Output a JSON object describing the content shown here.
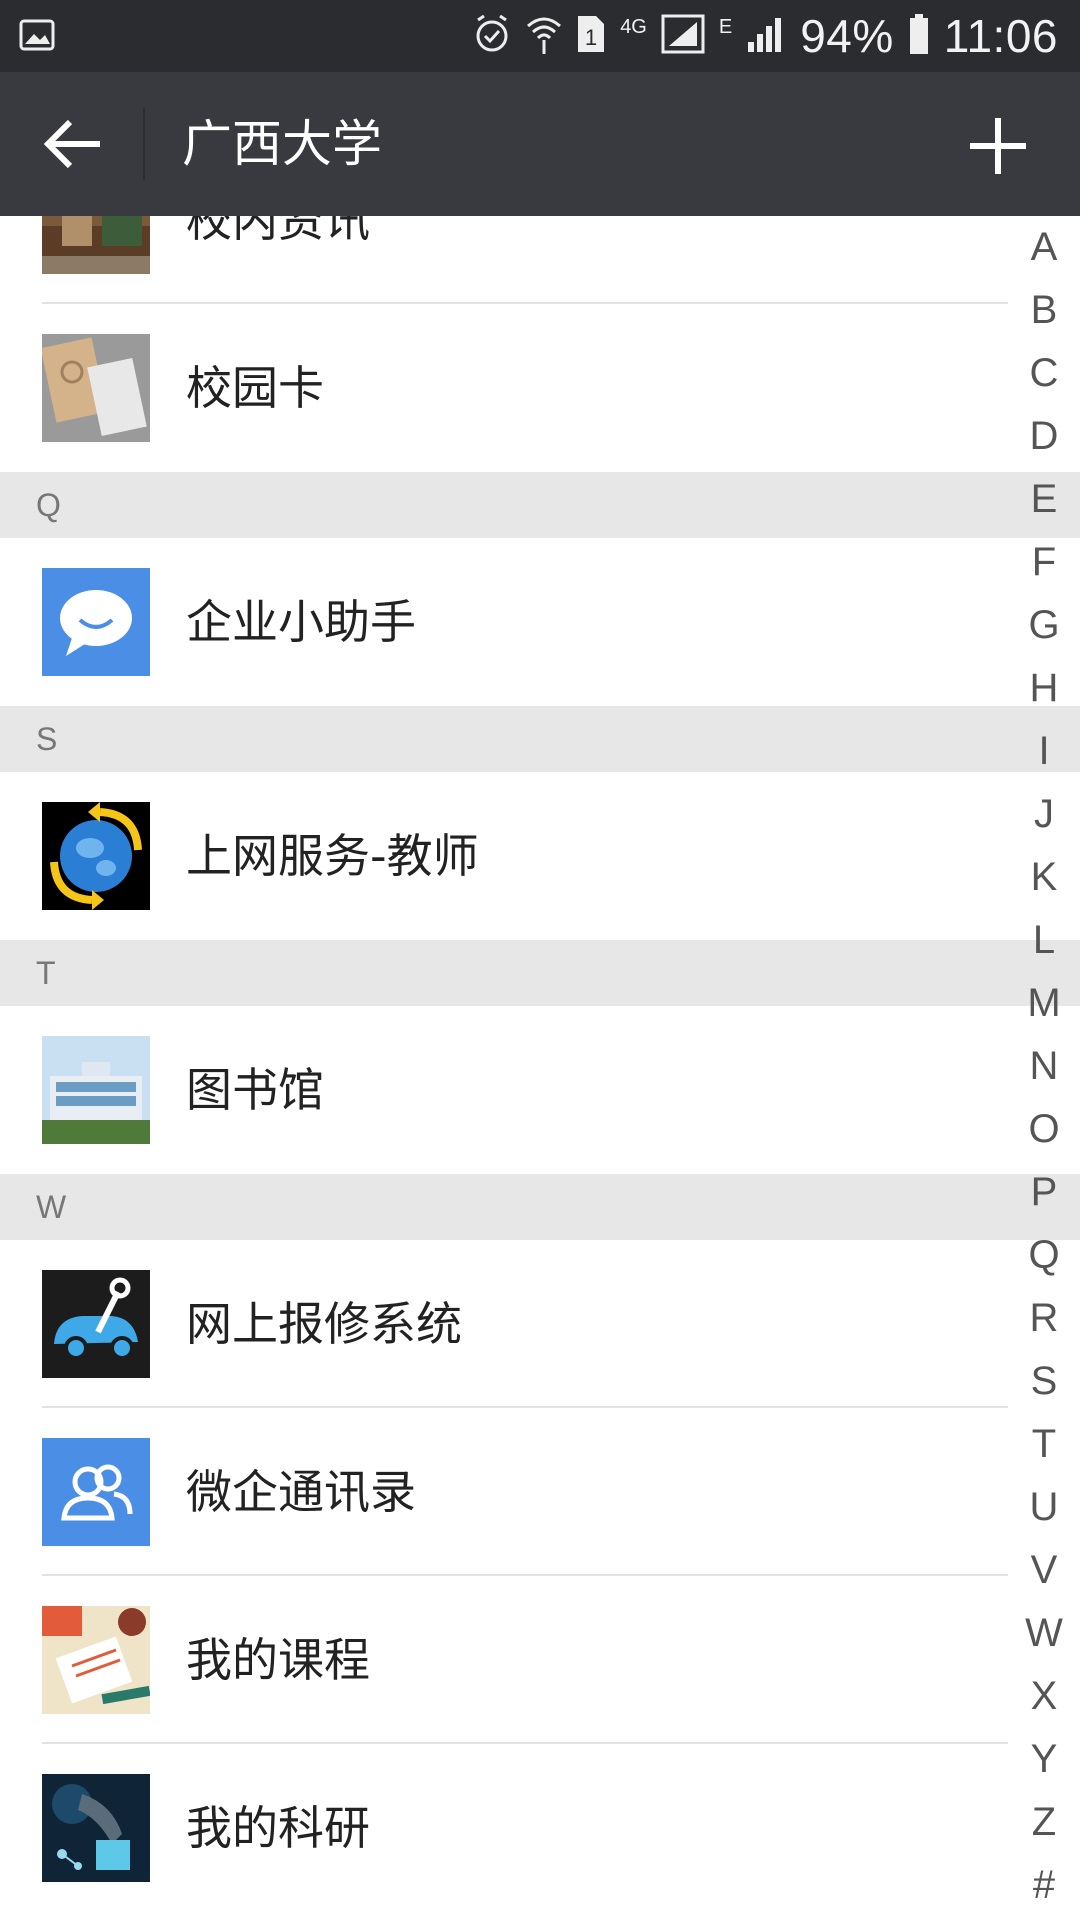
{
  "status_bar": {
    "network_type": "4G",
    "edge_label": "E",
    "battery": "94%",
    "time": "11:06",
    "icons": [
      "gallery-icon",
      "alarm-icon",
      "wifi-icon",
      "sim1-icon",
      "signal-icon",
      "battery-icon"
    ]
  },
  "title_bar": {
    "title": "广西大学",
    "back_icon": "arrow-left-icon",
    "add_icon": "plus-icon"
  },
  "list": {
    "items_top": [
      {
        "label": "校内资讯",
        "icon": "campus-photo"
      },
      {
        "label": "校园卡",
        "icon": "card-photo"
      }
    ],
    "sections": [
      {
        "letter": "Q",
        "items": [
          {
            "label": "企业小助手",
            "icon": "chat-bubble-icon"
          }
        ]
      },
      {
        "letter": "S",
        "items": [
          {
            "label": "上网服务-教师",
            "icon": "globe-icon"
          }
        ]
      },
      {
        "letter": "T",
        "items": [
          {
            "label": "图书馆",
            "icon": "library-photo"
          }
        ]
      },
      {
        "letter": "W",
        "items": [
          {
            "label": "网上报修系统",
            "icon": "repair-icon"
          },
          {
            "label": "微企通讯录",
            "icon": "contacts-icon"
          },
          {
            "label": "我的课程",
            "icon": "curriculum-photo"
          },
          {
            "label": "我的科研",
            "icon": "research-photo"
          }
        ]
      }
    ]
  },
  "alphabet_index": [
    "A",
    "B",
    "C",
    "D",
    "E",
    "F",
    "G",
    "H",
    "I",
    "J",
    "K",
    "L",
    "M",
    "N",
    "O",
    "P",
    "Q",
    "R",
    "S",
    "T",
    "U",
    "V",
    "W",
    "X",
    "Y",
    "Z",
    "#"
  ],
  "colors": {
    "status_bar": "#2b2c30",
    "title_bar": "#393a3f",
    "section_header": "#e7e7e7",
    "accent_blue": "#4a8ee6"
  }
}
